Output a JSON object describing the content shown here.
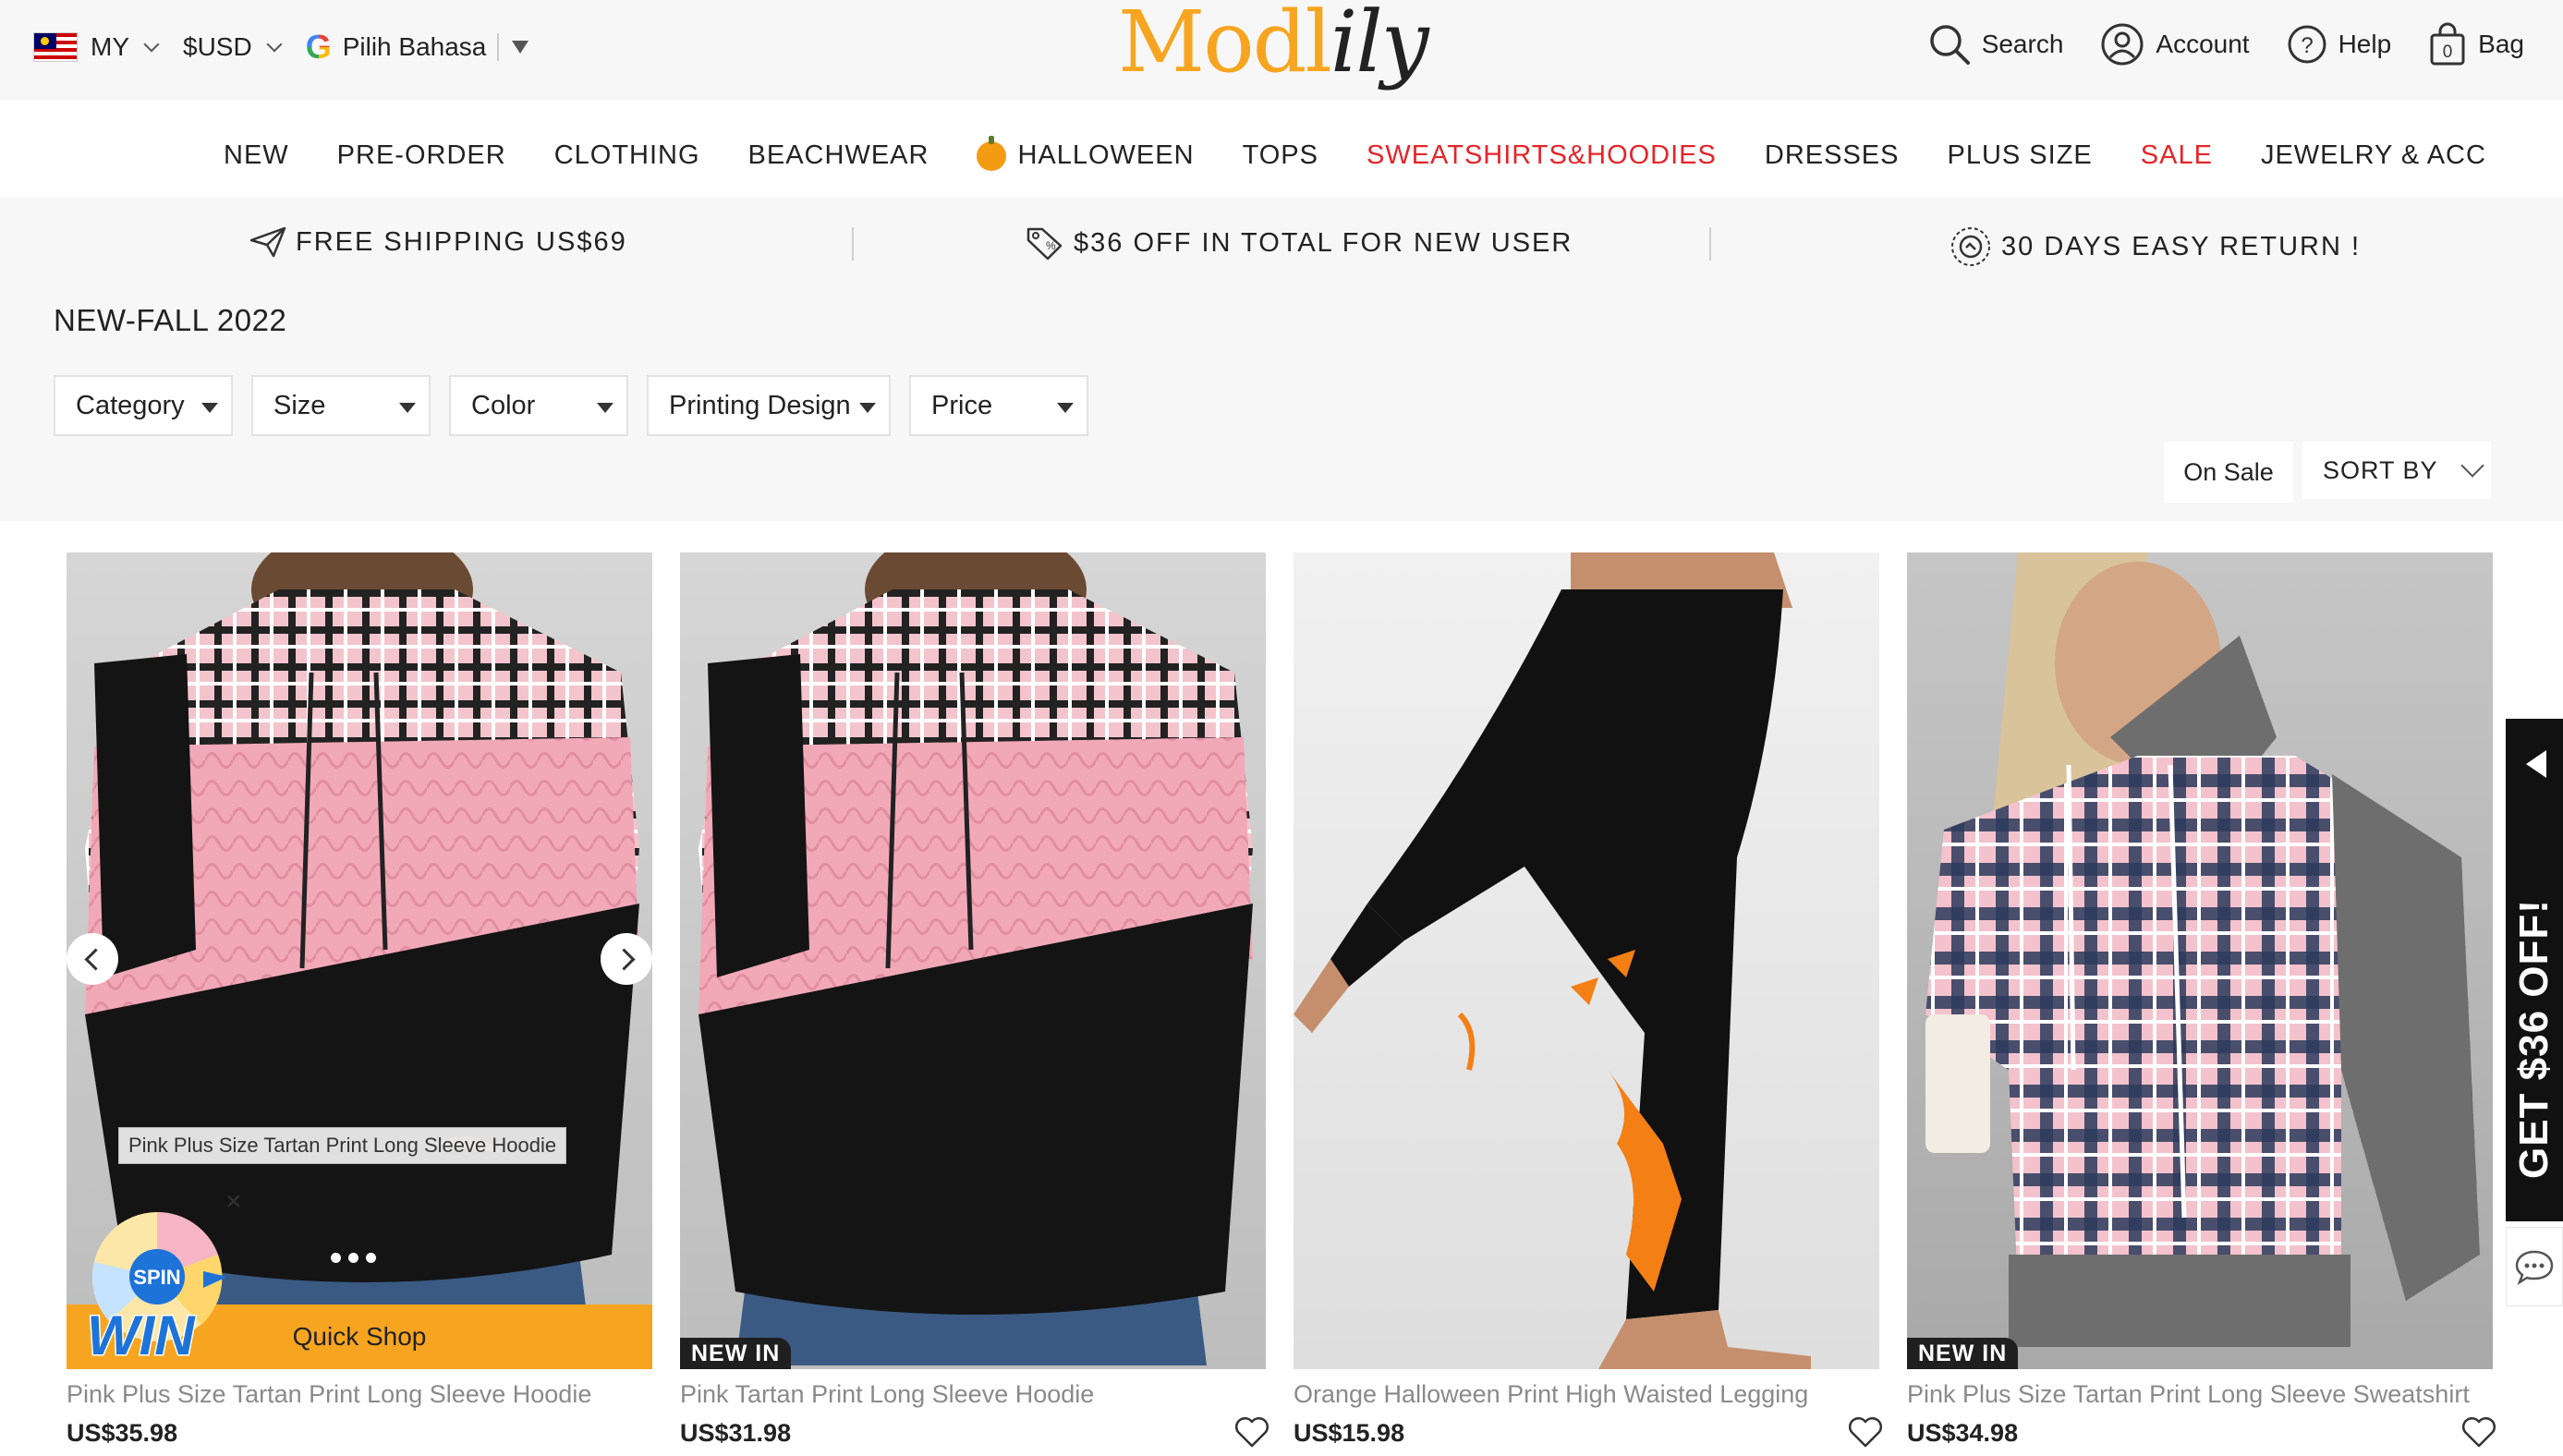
{
  "topbar": {
    "region": "MY",
    "currency": "$USD",
    "language": "Pilih Bahasa",
    "logo": {
      "main": "Modl",
      "tail": "ily"
    },
    "search_label": "Search",
    "account_label": "Account",
    "help_label": "Help",
    "bag_label": "Bag",
    "bag_count": "0"
  },
  "nav": {
    "items": [
      {
        "label": "NEW"
      },
      {
        "label": "PRE-ORDER"
      },
      {
        "label": "CLOTHING"
      },
      {
        "label": "BEACHWEAR"
      },
      {
        "label": "HALLOWEEN"
      },
      {
        "label": "TOPS"
      },
      {
        "label": "SWEATSHIRTS&HOODIES"
      },
      {
        "label": "DRESSES"
      },
      {
        "label": "PLUS SIZE"
      },
      {
        "label": "SALE"
      },
      {
        "label": "JEWELRY & ACC"
      }
    ],
    "highlight_color": "#e4252b"
  },
  "promo": {
    "shipping": "FREE SHIPPING US$69",
    "new_user": "$36 OFF IN TOTAL FOR NEW USER",
    "returns": "30 DAYS EASY RETURN !"
  },
  "page": {
    "title": "NEW-FALL 2022",
    "filters": [
      "Category",
      "Size",
      "Color",
      "Printing Design",
      "Price"
    ],
    "on_sale": "On Sale",
    "sort_by": "SORT BY"
  },
  "products": [
    {
      "title": "Pink Plus Size Tartan Print Long Sleeve Hoodie",
      "price": "US$35.98",
      "tooltip": "Pink Plus Size Tartan Print Long Sleeve Hoodie",
      "quick_shop": "Quick Shop",
      "badge": ""
    },
    {
      "title": "Pink Tartan Print Long Sleeve Hoodie",
      "price": "US$31.98",
      "badge": "NEW IN"
    },
    {
      "title": "Orange Halloween Print High Waisted Legging",
      "price": "US$15.98",
      "badge": ""
    },
    {
      "title": "Pink Plus Size Tartan Print Long Sleeve Sweatshirt",
      "price": "US$34.98",
      "badge": "NEW IN"
    }
  ],
  "spin_win": {
    "spin": "SPIN",
    "win": "WIN"
  },
  "side_tab": {
    "label": "GET $36 OFF!"
  },
  "colors": {
    "accent": "#f7a520",
    "sale_red": "#e4252b",
    "dark": "#1f1f1f"
  }
}
